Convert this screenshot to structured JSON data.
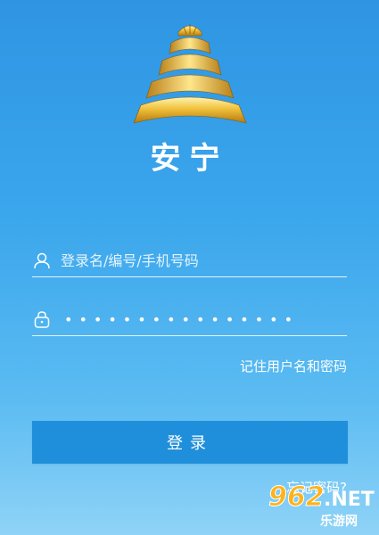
{
  "app": {
    "title": "安宁"
  },
  "login_form": {
    "username_placeholder": "登录名/编号/手机号码",
    "password_masked": "••••••••••••••••",
    "remember_label": "记住用户名和密码",
    "login_button_label": "登录",
    "forgot_password_label": "忘记密码?"
  },
  "watermark": {
    "number": "962",
    "domain": ".NET",
    "sub": "乐游网"
  },
  "colors": {
    "background_top": "#2f95e3",
    "background_bottom": "#8fd3f7",
    "button": "#1f8fdb",
    "logo_gold": "#e8b730"
  },
  "icons": {
    "username": "user-icon",
    "password": "lock-icon"
  }
}
